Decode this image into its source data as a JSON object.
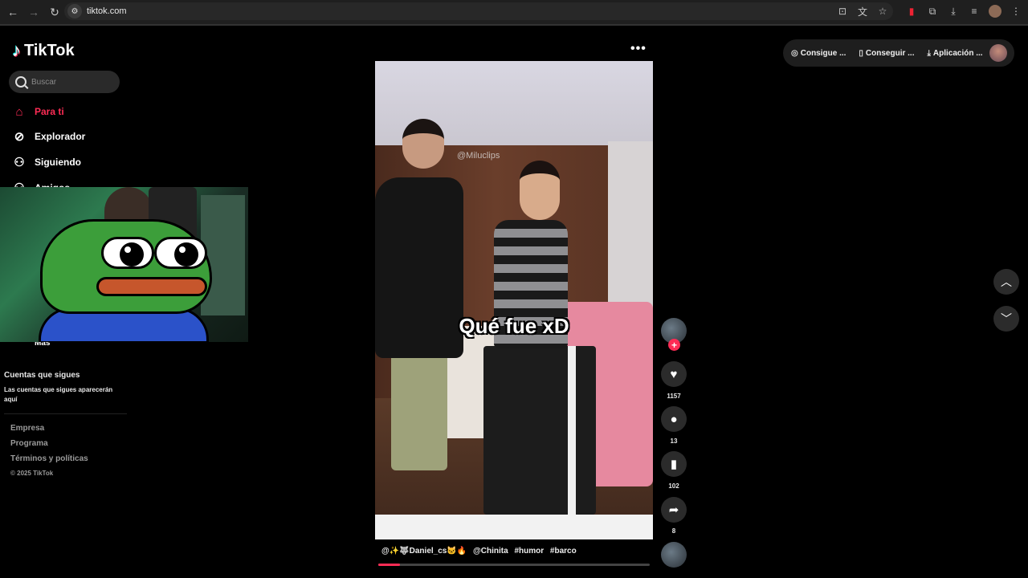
{
  "browser": {
    "url": "tiktok.com",
    "icons": {
      "back": "arrow-left-icon",
      "forward": "arrow-right-icon",
      "reload": "reload-icon"
    }
  },
  "sidebar": {
    "brand": "TikTok",
    "search_placeholder": "Buscar",
    "nav": [
      {
        "label": "Para ti",
        "icon": "home-icon",
        "active": true
      },
      {
        "label": "Explorador",
        "icon": "compass-icon"
      },
      {
        "label": "Siguiendo",
        "icon": "following-icon"
      },
      {
        "label": "Amigos",
        "icon": "friends-icon"
      }
    ],
    "more_label": "Más",
    "following_heading": "Cuentas que sigues",
    "following_desc": "Las cuentas que sigues aparecerán aquí",
    "footer": [
      "Empresa",
      "Programa",
      "Términos y políticas"
    ],
    "copyright": "© 2025 TikTok"
  },
  "video": {
    "watermark": "@Miluclips",
    "overlay_caption": "Qué fue xD",
    "description_user": "@✨🐺Daniel_cs🐱🔥",
    "description_mention": "@Chinita",
    "tags": [
      "#humor",
      "#barco"
    ],
    "progress": 0.08
  },
  "actions": {
    "likes": "1157",
    "comments": "13",
    "saves": "102",
    "shares": "8"
  },
  "top_actions": [
    {
      "label": "Consigue ...",
      "icon": "coin-icon"
    },
    {
      "label": "Conseguir ...",
      "icon": "phone-icon"
    },
    {
      "label": "Aplicación ...",
      "icon": "download-icon"
    }
  ],
  "colors": {
    "accent": "#fe2c55",
    "background": "#000000"
  }
}
